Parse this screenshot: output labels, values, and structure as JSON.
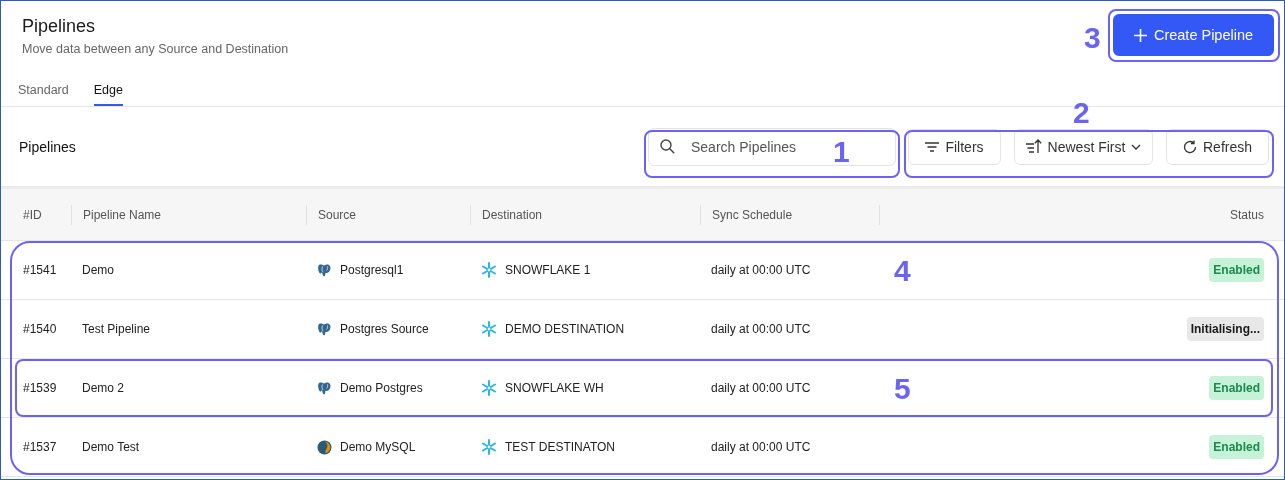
{
  "header": {
    "title": "Pipelines",
    "subtitle": "Move data between any Source and Destination",
    "create_button": "Create Pipeline"
  },
  "tabs": [
    {
      "label": "Standard",
      "selected": false
    },
    {
      "label": "Edge",
      "selected": true
    }
  ],
  "toolbar": {
    "title": "Pipelines",
    "search": {
      "placeholder": "Search Pipelines"
    },
    "filters_button": "Filters",
    "sort_button": "Newest First",
    "refresh_button": "Refresh"
  },
  "table": {
    "columns": [
      "#ID",
      "Pipeline Name",
      "Source",
      "Destination",
      "Sync Schedule",
      "Status"
    ],
    "rows": [
      {
        "id": "#1541",
        "name": "Demo",
        "source": {
          "kind": "postgres",
          "name": "Postgresql1"
        },
        "destination": {
          "kind": "snowflake",
          "name": "SNOWFLAKE 1"
        },
        "schedule": "daily at 00:00 UTC",
        "status": {
          "kind": "enabled",
          "label": "Enabled"
        }
      },
      {
        "id": "#1540",
        "name": "Test Pipeline",
        "source": {
          "kind": "postgres",
          "name": "Postgres Source"
        },
        "destination": {
          "kind": "snowflake",
          "name": "DEMO DESTINATION"
        },
        "schedule": "daily at 00:00 UTC",
        "status": {
          "kind": "initialising",
          "label": "Initialising..."
        }
      },
      {
        "id": "#1539",
        "name": "Demo 2",
        "source": {
          "kind": "postgres",
          "name": "Demo Postgres"
        },
        "destination": {
          "kind": "snowflake",
          "name": "SNOWFLAKE WH"
        },
        "schedule": "daily at 00:00 UTC",
        "status": {
          "kind": "enabled",
          "label": "Enabled"
        }
      },
      {
        "id": "#1537",
        "name": "Demo Test",
        "source": {
          "kind": "mysql",
          "name": "Demo MySQL"
        },
        "destination": {
          "kind": "snowflake",
          "name": "TEST DESTINATON"
        },
        "schedule": "daily at 00:00 UTC",
        "status": {
          "kind": "enabled",
          "label": "Enabled"
        }
      }
    ]
  },
  "callouts": [
    {
      "label": "1"
    },
    {
      "label": "2"
    },
    {
      "label": "3"
    },
    {
      "label": "4"
    },
    {
      "label": "5"
    }
  ]
}
